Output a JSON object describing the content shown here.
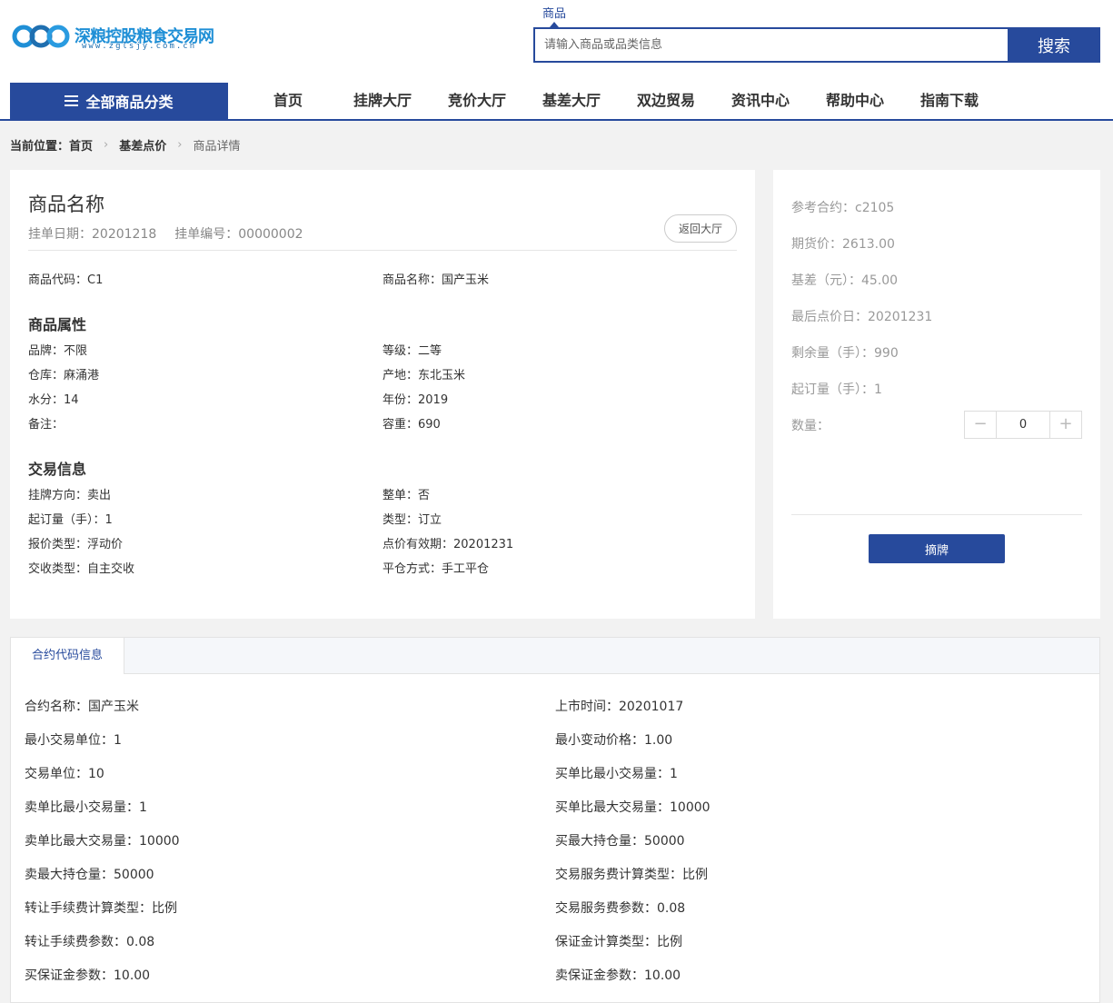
{
  "header": {
    "logo_name": "深粮控股粮食交易网",
    "logo_url": "www.zglsjy.com.cn",
    "search_tab": "商品",
    "search_placeholder": "请输入商品或品类信息",
    "search_button": "搜索"
  },
  "nav": {
    "all_categories": "全部商品分类",
    "items": [
      "首页",
      "挂牌大厅",
      "竞价大厅",
      "基差大厅",
      "双边贸易",
      "资讯中心",
      "帮助中心",
      "指南下载"
    ]
  },
  "breadcrumb": {
    "prefix": "当前位置：",
    "items": [
      "首页",
      "基差点价",
      "商品详情"
    ],
    "separator": "›"
  },
  "detail": {
    "title": "商品名称",
    "listing_date": "挂单日期：20201218",
    "listing_no": "挂单编号：00000002",
    "back_button": "返回大厅",
    "code": "商品代码：C1",
    "name": "商品名称：国产玉米",
    "attr_title": "商品属性",
    "attrs": {
      "brand": "品牌：不限",
      "grade": "等级：二等",
      "warehouse": "仓库：麻涌港",
      "origin": "产地：东北玉米",
      "moisture": "水分：14",
      "year": "年份：2019",
      "remark": "备注：",
      "density": "容重：690"
    },
    "trade_title": "交易信息",
    "trade": {
      "direction": "挂牌方向：卖出",
      "whole": "整单：否",
      "min_order": "起订量（手）：1",
      "type": "类型：订立",
      "quote_type": "报价类型：浮动价",
      "pricing_valid": "点价有效期：20201231",
      "delivery_type": "交收类型：自主交收",
      "close_method": "平仓方式：手工平仓"
    }
  },
  "side": {
    "ref_contract": "参考合约：c2105",
    "futures_price": "期货价：2613.00",
    "basis": "基差（元）：45.00",
    "last_pricing_day": "最后点价日：20201231",
    "remaining": "剩余量（手）：990",
    "min_order": "起订量（手）：1",
    "qty_label": "数量：",
    "qty_value": "0",
    "minus": "−",
    "plus": "+",
    "pick_button": "摘牌"
  },
  "contract": {
    "tab": "合约代码信息",
    "left": [
      "合约名称：国产玉米",
      "最小交易单位：1",
      "交易单位：10",
      "卖单比最小交易量：1",
      "卖单比最大交易量：10000",
      "卖最大持仓量：50000",
      "转让手续费计算类型：比例",
      "转让手续费参数：0.08",
      "买保证金参数：10.00"
    ],
    "right": [
      "上市时间：20201017",
      "最小变动价格：1.00",
      "买单比最小交易量：1",
      "买单比最大交易量：10000",
      "买最大持仓量：50000",
      "交易服务费计算类型：比例",
      "交易服务费参数：0.08",
      "保证金计算类型：比例",
      "卖保证金参数：10.00"
    ]
  },
  "colors": {
    "brand": "#274a9c",
    "logo": "#1f8fd6"
  }
}
